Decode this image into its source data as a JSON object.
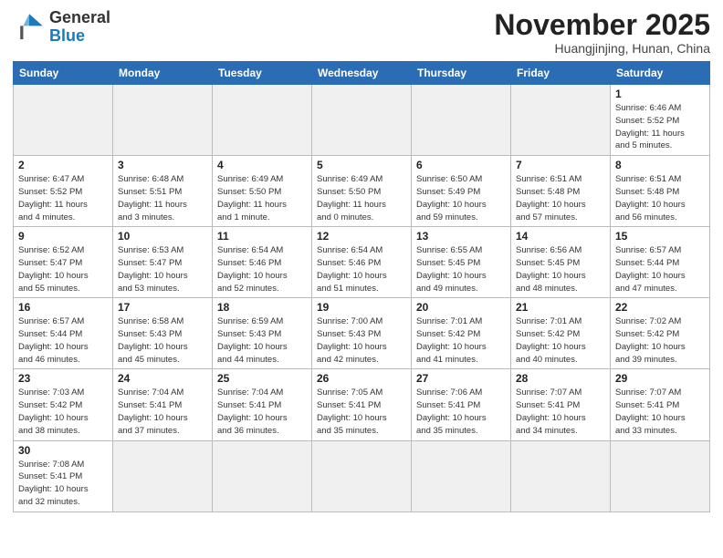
{
  "header": {
    "logo_general": "General",
    "logo_blue": "Blue",
    "month_title": "November 2025",
    "subtitle": "Huangjinjing, Hunan, China"
  },
  "weekdays": [
    "Sunday",
    "Monday",
    "Tuesday",
    "Wednesday",
    "Thursday",
    "Friday",
    "Saturday"
  ],
  "weeks": [
    [
      {
        "day": "",
        "info": ""
      },
      {
        "day": "",
        "info": ""
      },
      {
        "day": "",
        "info": ""
      },
      {
        "day": "",
        "info": ""
      },
      {
        "day": "",
        "info": ""
      },
      {
        "day": "",
        "info": ""
      },
      {
        "day": "1",
        "info": "Sunrise: 6:46 AM\nSunset: 5:52 PM\nDaylight: 11 hours\nand 5 minutes."
      }
    ],
    [
      {
        "day": "2",
        "info": "Sunrise: 6:47 AM\nSunset: 5:52 PM\nDaylight: 11 hours\nand 4 minutes."
      },
      {
        "day": "3",
        "info": "Sunrise: 6:48 AM\nSunset: 5:51 PM\nDaylight: 11 hours\nand 3 minutes."
      },
      {
        "day": "4",
        "info": "Sunrise: 6:49 AM\nSunset: 5:50 PM\nDaylight: 11 hours\nand 1 minute."
      },
      {
        "day": "5",
        "info": "Sunrise: 6:49 AM\nSunset: 5:50 PM\nDaylight: 11 hours\nand 0 minutes."
      },
      {
        "day": "6",
        "info": "Sunrise: 6:50 AM\nSunset: 5:49 PM\nDaylight: 10 hours\nand 59 minutes."
      },
      {
        "day": "7",
        "info": "Sunrise: 6:51 AM\nSunset: 5:48 PM\nDaylight: 10 hours\nand 57 minutes."
      },
      {
        "day": "8",
        "info": "Sunrise: 6:51 AM\nSunset: 5:48 PM\nDaylight: 10 hours\nand 56 minutes."
      }
    ],
    [
      {
        "day": "9",
        "info": "Sunrise: 6:52 AM\nSunset: 5:47 PM\nDaylight: 10 hours\nand 55 minutes."
      },
      {
        "day": "10",
        "info": "Sunrise: 6:53 AM\nSunset: 5:47 PM\nDaylight: 10 hours\nand 53 minutes."
      },
      {
        "day": "11",
        "info": "Sunrise: 6:54 AM\nSunset: 5:46 PM\nDaylight: 10 hours\nand 52 minutes."
      },
      {
        "day": "12",
        "info": "Sunrise: 6:54 AM\nSunset: 5:46 PM\nDaylight: 10 hours\nand 51 minutes."
      },
      {
        "day": "13",
        "info": "Sunrise: 6:55 AM\nSunset: 5:45 PM\nDaylight: 10 hours\nand 49 minutes."
      },
      {
        "day": "14",
        "info": "Sunrise: 6:56 AM\nSunset: 5:45 PM\nDaylight: 10 hours\nand 48 minutes."
      },
      {
        "day": "15",
        "info": "Sunrise: 6:57 AM\nSunset: 5:44 PM\nDaylight: 10 hours\nand 47 minutes."
      }
    ],
    [
      {
        "day": "16",
        "info": "Sunrise: 6:57 AM\nSunset: 5:44 PM\nDaylight: 10 hours\nand 46 minutes."
      },
      {
        "day": "17",
        "info": "Sunrise: 6:58 AM\nSunset: 5:43 PM\nDaylight: 10 hours\nand 45 minutes."
      },
      {
        "day": "18",
        "info": "Sunrise: 6:59 AM\nSunset: 5:43 PM\nDaylight: 10 hours\nand 44 minutes."
      },
      {
        "day": "19",
        "info": "Sunrise: 7:00 AM\nSunset: 5:43 PM\nDaylight: 10 hours\nand 42 minutes."
      },
      {
        "day": "20",
        "info": "Sunrise: 7:01 AM\nSunset: 5:42 PM\nDaylight: 10 hours\nand 41 minutes."
      },
      {
        "day": "21",
        "info": "Sunrise: 7:01 AM\nSunset: 5:42 PM\nDaylight: 10 hours\nand 40 minutes."
      },
      {
        "day": "22",
        "info": "Sunrise: 7:02 AM\nSunset: 5:42 PM\nDaylight: 10 hours\nand 39 minutes."
      }
    ],
    [
      {
        "day": "23",
        "info": "Sunrise: 7:03 AM\nSunset: 5:42 PM\nDaylight: 10 hours\nand 38 minutes."
      },
      {
        "day": "24",
        "info": "Sunrise: 7:04 AM\nSunset: 5:41 PM\nDaylight: 10 hours\nand 37 minutes."
      },
      {
        "day": "25",
        "info": "Sunrise: 7:04 AM\nSunset: 5:41 PM\nDaylight: 10 hours\nand 36 minutes."
      },
      {
        "day": "26",
        "info": "Sunrise: 7:05 AM\nSunset: 5:41 PM\nDaylight: 10 hours\nand 35 minutes."
      },
      {
        "day": "27",
        "info": "Sunrise: 7:06 AM\nSunset: 5:41 PM\nDaylight: 10 hours\nand 35 minutes."
      },
      {
        "day": "28",
        "info": "Sunrise: 7:07 AM\nSunset: 5:41 PM\nDaylight: 10 hours\nand 34 minutes."
      },
      {
        "day": "29",
        "info": "Sunrise: 7:07 AM\nSunset: 5:41 PM\nDaylight: 10 hours\nand 33 minutes."
      }
    ],
    [
      {
        "day": "30",
        "info": "Sunrise: 7:08 AM\nSunset: 5:41 PM\nDaylight: 10 hours\nand 32 minutes."
      },
      {
        "day": "",
        "info": ""
      },
      {
        "day": "",
        "info": ""
      },
      {
        "day": "",
        "info": ""
      },
      {
        "day": "",
        "info": ""
      },
      {
        "day": "",
        "info": ""
      },
      {
        "day": "",
        "info": ""
      }
    ]
  ]
}
